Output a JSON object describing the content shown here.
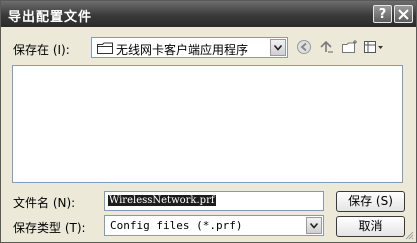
{
  "window": {
    "title": "导出配置文件"
  },
  "titlebar": {
    "help_glyph": "?"
  },
  "save_in": {
    "label": "保存在 (I):",
    "value": "无线网卡客户端应用程序"
  },
  "filename": {
    "label": "文件名 (N):",
    "value": "WirelessNetwork.prf"
  },
  "filetype": {
    "label": "保存类型 (T):",
    "value": "Config files (*.prf)"
  },
  "buttons": {
    "save": "保存 (S)",
    "cancel": "取消"
  },
  "icons": [
    "folder-icon",
    "back-icon",
    "up-folder-icon",
    "new-folder-icon",
    "views-menu-icon",
    "close-icon",
    "help-icon"
  ],
  "colors": {
    "titlebar": "#3a3a3a",
    "dialog_bg": "#ece9d8",
    "field_border": "#7f9db9"
  }
}
